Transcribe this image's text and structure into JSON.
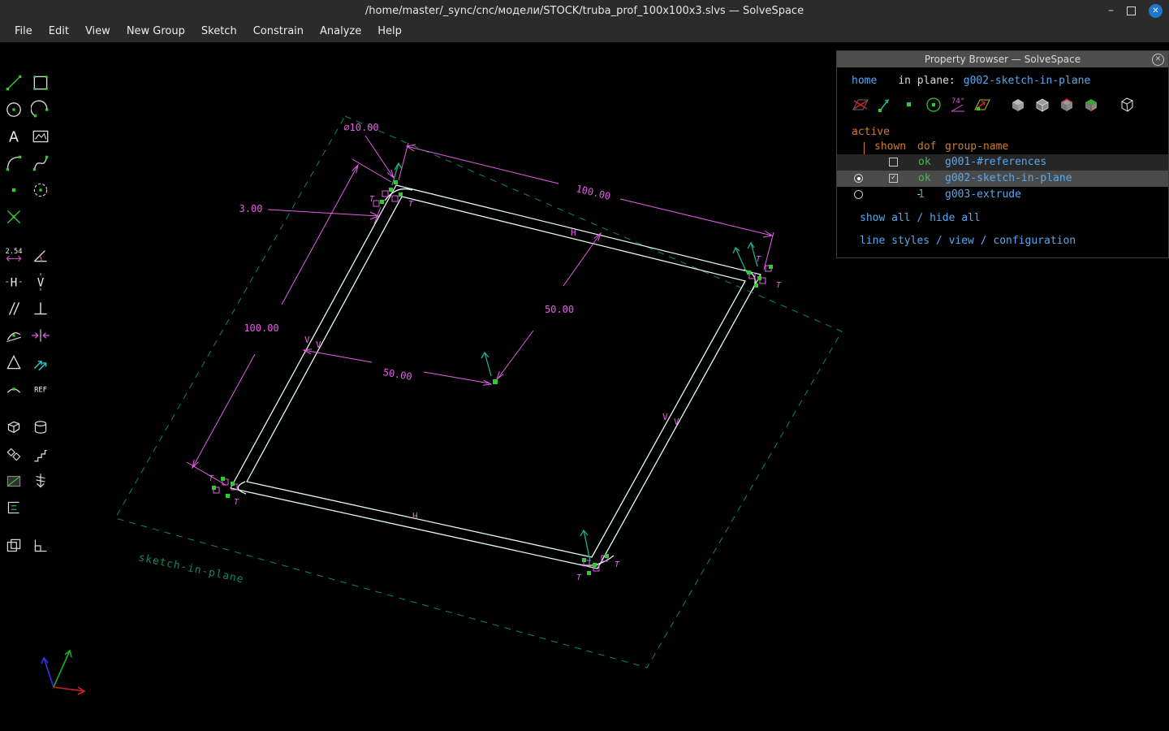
{
  "window": {
    "title": "/home/master/_sync/cnc/модели/STOCK/truba_prof_100x100x3.slvs — SolveSpace",
    "minimize": "–",
    "close": "✕"
  },
  "menu": {
    "items": [
      "File",
      "Edit",
      "View",
      "New Group",
      "Sketch",
      "Constrain",
      "Analyze",
      "Help"
    ]
  },
  "toolbar": {
    "text_tool": "A",
    "distance": "2.54",
    "horizontal": "H",
    "vertical": "V",
    "ref": "REF"
  },
  "canvas": {
    "dims": {
      "diameter": "⌀10.00",
      "wall": "3.00",
      "top_width": "100.00",
      "left_height": "100.00",
      "half_vertical": "50.00",
      "half_horizontal": "50.00"
    },
    "markers": {
      "h": "H",
      "v": "V",
      "t": "T"
    },
    "plane_label": "sketch-in-plane"
  },
  "property_browser": {
    "title": "Property Browser — SolveSpace",
    "close_glyph": "✕",
    "home": "home",
    "in_plane_label": "in plane:",
    "in_plane_value": "g002-sketch-in-plane",
    "angle_label": "74°",
    "active_label": "active",
    "check_glyph": "✓",
    "headers": {
      "shown": "shown",
      "dof": "dof",
      "group": "group-name"
    },
    "rows": [
      {
        "dof": "ok",
        "name": "g001-#references"
      },
      {
        "dof": "ok",
        "name": "g002-sketch-in-plane"
      },
      {
        "shown": "-",
        "dof": "1",
        "name": "g003-extrude"
      }
    ],
    "links": {
      "show_all": "show all",
      "hide_all": "hide all",
      "line_styles": "line styles",
      "view": "view",
      "configuration": "configuration",
      "sep": " / "
    }
  }
}
